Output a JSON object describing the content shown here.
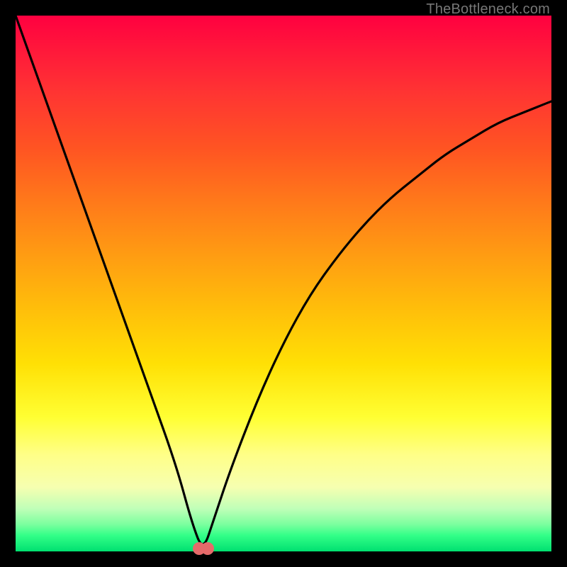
{
  "watermark": "TheBottleneck.com",
  "colors": {
    "background": "#000000",
    "curve": "#000000",
    "marker": "#e66a6a"
  },
  "chart_data": {
    "type": "line",
    "title": "",
    "xlabel": "",
    "ylabel": "",
    "xlim": [
      0,
      100
    ],
    "ylim": [
      0,
      100
    ],
    "grid": false,
    "legend": false,
    "background_gradient": "red-to-green (vertical)",
    "description": "V-shaped bottleneck curve: steep linear descent from top-left to a minimum near x≈35, then a concave-up rise toward the right that levels off below the top edge.",
    "series": [
      {
        "name": "bottleneck-curve",
        "x": [
          0,
          5,
          10,
          15,
          20,
          25,
          30,
          33,
          35,
          37,
          40,
          45,
          50,
          55,
          60,
          65,
          70,
          75,
          80,
          85,
          90,
          95,
          100
        ],
        "y": [
          100,
          86,
          72,
          58,
          44,
          30,
          16,
          5,
          0,
          6,
          15,
          28,
          39,
          48,
          55,
          61,
          66,
          70,
          74,
          77,
          80,
          82,
          84
        ]
      }
    ],
    "markers": [
      {
        "name": "optimum-a",
        "x": 34.2,
        "y": 0.5
      },
      {
        "name": "optimum-b",
        "x": 35.8,
        "y": 0.5
      }
    ]
  }
}
